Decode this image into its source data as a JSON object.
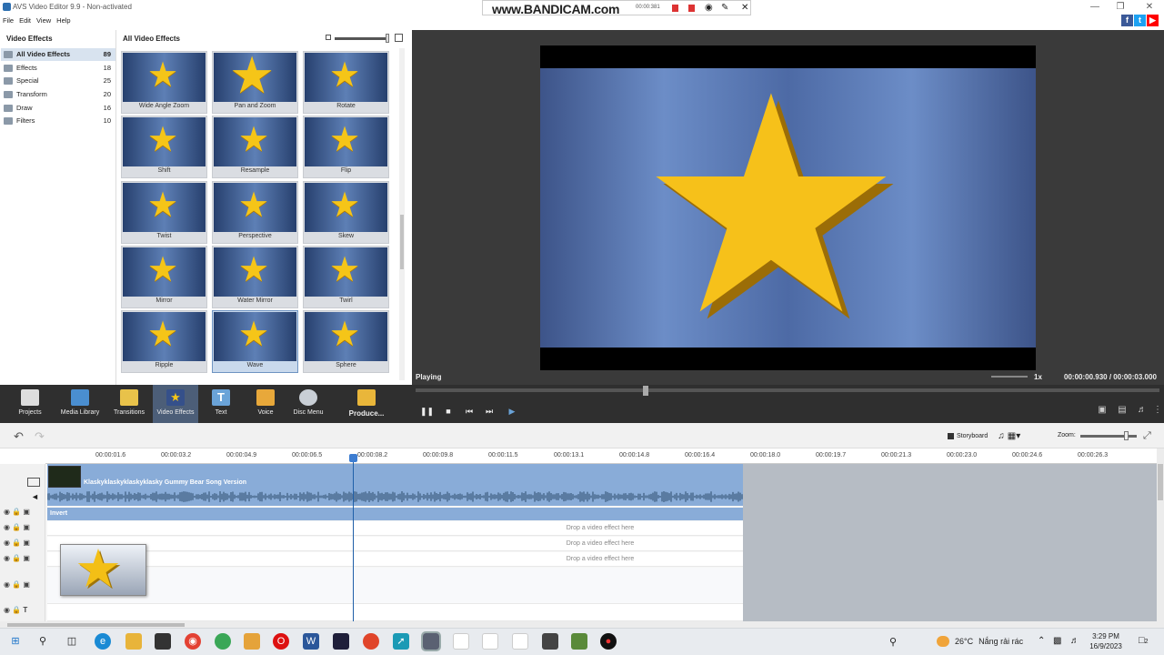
{
  "window": {
    "title": "AVS Video Editor 9.9 - Non-activated"
  },
  "menu": [
    "File",
    "Edit",
    "View",
    "Help"
  ],
  "recorder": {
    "brand": "www.BANDICAM.com",
    "time": "00:00:381"
  },
  "effects_tree": {
    "header": "Video Effects",
    "items": [
      {
        "label": "All Video Effects",
        "count": "89"
      },
      {
        "label": "Effects",
        "count": "18"
      },
      {
        "label": "Special",
        "count": "25"
      },
      {
        "label": "Transform",
        "count": "20"
      },
      {
        "label": "Draw",
        "count": "16"
      },
      {
        "label": "Filters",
        "count": "10"
      }
    ]
  },
  "effects_grid": {
    "header": "All Video Effects",
    "tiles": [
      "Wide Angle Zoom",
      "Pan and Zoom",
      "Rotate",
      "Shift",
      "Resample",
      "Flip",
      "Twist",
      "Perspective",
      "Skew",
      "Mirror",
      "Water Mirror",
      "Twirl",
      "Ripple",
      "Wave",
      "Sphere"
    ],
    "selected": "Wave"
  },
  "preview": {
    "status": "Playing",
    "speed": "1x",
    "time_current": "00:00:00.930",
    "time_separator": "/",
    "time_total": "00:00:03.000"
  },
  "toolbar": {
    "projects": "Projects",
    "media_library": "Media Library",
    "transitions": "Transitions",
    "video_effects": "Video Effects",
    "text": "Text",
    "voice": "Voice",
    "disc_menu": "Disc Menu",
    "produce": "Produce..."
  },
  "timeline": {
    "storyboard": "Storyboard",
    "zoom_label": "Zoom:",
    "ticks": [
      "00:00:01.6",
      "00:00:03.2",
      "00:00:04.9",
      "00:00:06.5",
      "00:00:08.2",
      "00:00:09.8",
      "00:00:11.5",
      "00:00:13.1",
      "00:00:14.8",
      "00:00:16.4",
      "00:00:18.0",
      "00:00:19.7",
      "00:00:21.3",
      "00:00:23.0",
      "00:00:24.6",
      "00:00:26.3"
    ],
    "clip_title": "Klaskyklaskyklaskyklasky Gummy Bear Song Version",
    "effect_label": "Invert",
    "drop_hint": "Drop a video effect here"
  },
  "taskbar": {
    "weather_temp": "26°C",
    "weather_text": "Nắng rải rác",
    "time": "3:29 PM",
    "date": "16/9/2023",
    "notif_count": "2"
  },
  "colors": {
    "accent": "#89acd8",
    "toolbar_bg": "#2f2f2f",
    "preview_bg": "#3a3a3a",
    "star": "#f5c518"
  }
}
